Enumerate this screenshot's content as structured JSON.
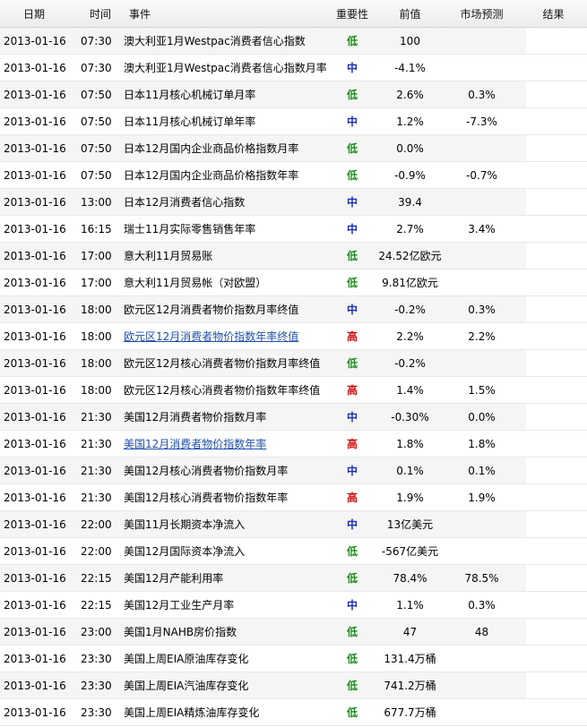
{
  "header": {
    "date": "日期",
    "time": "时间",
    "event": "事件",
    "importance": "重要性",
    "previous": "前值",
    "forecast": "市场预测",
    "result": "结果"
  },
  "colors": {
    "low": "#1a8c1a",
    "mid": "#1a2fb0",
    "high": "#cc1111",
    "link": "#1f4fa8"
  },
  "rows": [
    {
      "date": "2013-01-16",
      "time": "07:30",
      "event": "澳大利亚1月Westpac消费者信心指数",
      "importance": "低",
      "level": "low",
      "previous": "100",
      "forecast": "",
      "result": "",
      "link": false
    },
    {
      "date": "2013-01-16",
      "time": "07:30",
      "event": "澳大利亚1月Westpac消费者信心指数月率",
      "importance": "中",
      "level": "mid",
      "previous": "-4.1%",
      "forecast": "",
      "result": "",
      "link": false
    },
    {
      "date": "2013-01-16",
      "time": "07:50",
      "event": "日本11月核心机械订单月率",
      "importance": "低",
      "level": "low",
      "previous": "2.6%",
      "forecast": "0.3%",
      "result": "",
      "link": false
    },
    {
      "date": "2013-01-16",
      "time": "07:50",
      "event": "日本11月核心机械订单年率",
      "importance": "中",
      "level": "mid",
      "previous": "1.2%",
      "forecast": "-7.3%",
      "result": "",
      "link": false
    },
    {
      "date": "2013-01-16",
      "time": "07:50",
      "event": "日本12月国内企业商品价格指数月率",
      "importance": "低",
      "level": "low",
      "previous": "0.0%",
      "forecast": "",
      "result": "",
      "link": false
    },
    {
      "date": "2013-01-16",
      "time": "07:50",
      "event": "日本12月国内企业商品价格指数年率",
      "importance": "低",
      "level": "low",
      "previous": "-0.9%",
      "forecast": "-0.7%",
      "result": "",
      "link": false
    },
    {
      "date": "2013-01-16",
      "time": "13:00",
      "event": "日本12月消费者信心指数",
      "importance": "中",
      "level": "mid",
      "previous": "39.4",
      "forecast": "",
      "result": "",
      "link": false
    },
    {
      "date": "2013-01-16",
      "time": "16:15",
      "event": "瑞士11月实际零售销售年率",
      "importance": "中",
      "level": "mid",
      "previous": "2.7%",
      "forecast": "3.4%",
      "result": "",
      "link": false
    },
    {
      "date": "2013-01-16",
      "time": "17:00",
      "event": "意大利11月贸易账",
      "importance": "低",
      "level": "low",
      "previous": "24.52亿欧元",
      "forecast": "",
      "result": "",
      "link": false
    },
    {
      "date": "2013-01-16",
      "time": "17:00",
      "event": "意大利11月贸易帐（对欧盟）",
      "importance": "低",
      "level": "low",
      "previous": "9.81亿欧元",
      "forecast": "",
      "result": "",
      "link": false
    },
    {
      "date": "2013-01-16",
      "time": "18:00",
      "event": "欧元区12月消费者物价指数月率终值",
      "importance": "中",
      "level": "mid",
      "previous": "-0.2%",
      "forecast": "0.3%",
      "result": "",
      "link": false
    },
    {
      "date": "2013-01-16",
      "time": "18:00",
      "event": "欧元区12月消费者物价指数年率终值",
      "importance": "高",
      "level": "high",
      "previous": "2.2%",
      "forecast": "2.2%",
      "result": "",
      "link": true
    },
    {
      "date": "2013-01-16",
      "time": "18:00",
      "event": "欧元区12月核心消费者物价指数月率终值",
      "importance": "低",
      "level": "low",
      "previous": "-0.2%",
      "forecast": "",
      "result": "",
      "link": false
    },
    {
      "date": "2013-01-16",
      "time": "18:00",
      "event": "欧元区12月核心消费者物价指数年率终值",
      "importance": "高",
      "level": "high",
      "previous": "1.4%",
      "forecast": "1.5%",
      "result": "",
      "link": false
    },
    {
      "date": "2013-01-16",
      "time": "21:30",
      "event": "美国12月消费者物价指数月率",
      "importance": "中",
      "level": "mid",
      "previous": "-0.30%",
      "forecast": "0.0%",
      "result": "",
      "link": false
    },
    {
      "date": "2013-01-16",
      "time": "21:30",
      "event": "美国12月消费者物价指数年率",
      "importance": "高",
      "level": "high",
      "previous": "1.8%",
      "forecast": "1.8%",
      "result": "",
      "link": true
    },
    {
      "date": "2013-01-16",
      "time": "21:30",
      "event": "美国12月核心消费者物价指数月率",
      "importance": "中",
      "level": "mid",
      "previous": "0.1%",
      "forecast": "0.1%",
      "result": "",
      "link": false
    },
    {
      "date": "2013-01-16",
      "time": "21:30",
      "event": "美国12月核心消费者物价指数年率",
      "importance": "高",
      "level": "high",
      "previous": "1.9%",
      "forecast": "1.9%",
      "result": "",
      "link": false
    },
    {
      "date": "2013-01-16",
      "time": "22:00",
      "event": "美国11月长期资本净流入",
      "importance": "中",
      "level": "mid",
      "previous": "13亿美元",
      "forecast": "",
      "result": "",
      "link": false
    },
    {
      "date": "2013-01-16",
      "time": "22:00",
      "event": "美国12月国际资本净流入",
      "importance": "低",
      "level": "low",
      "previous": "-567亿美元",
      "forecast": "",
      "result": "",
      "link": false
    },
    {
      "date": "2013-01-16",
      "time": "22:15",
      "event": "美国12月产能利用率",
      "importance": "低",
      "level": "low",
      "previous": "78.4%",
      "forecast": "78.5%",
      "result": "",
      "link": false
    },
    {
      "date": "2013-01-16",
      "time": "22:15",
      "event": "美国12月工业生产月率",
      "importance": "中",
      "level": "mid",
      "previous": "1.1%",
      "forecast": "0.3%",
      "result": "",
      "link": false
    },
    {
      "date": "2013-01-16",
      "time": "23:00",
      "event": "美国1月NAHB房价指数",
      "importance": "低",
      "level": "low",
      "previous": "47",
      "forecast": "48",
      "result": "",
      "link": false
    },
    {
      "date": "2013-01-16",
      "time": "23:30",
      "event": "美国上周EIA原油库存变化",
      "importance": "低",
      "level": "low",
      "previous": "131.4万桶",
      "forecast": "",
      "result": "",
      "link": false
    },
    {
      "date": "2013-01-16",
      "time": "23:30",
      "event": "美国上周EIA汽油库存变化",
      "importance": "低",
      "level": "low",
      "previous": "741.2万桶",
      "forecast": "",
      "result": "",
      "link": false
    },
    {
      "date": "2013-01-16",
      "time": "23:30",
      "event": "美国上周EIA精炼油库存变化",
      "importance": "低",
      "level": "low",
      "previous": "677.7万桶",
      "forecast": "",
      "result": "",
      "link": false
    }
  ]
}
